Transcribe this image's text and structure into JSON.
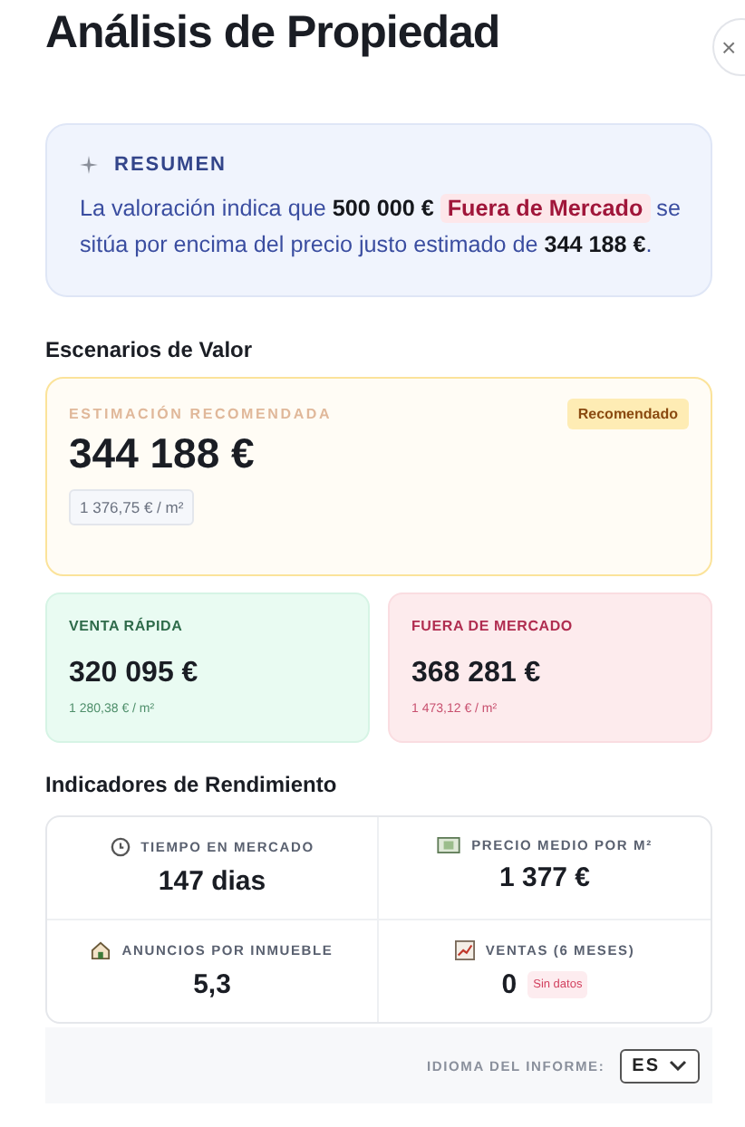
{
  "title": "Análisis de Propiedad",
  "close_button": {
    "label": "×"
  },
  "summary": {
    "heading": "RESUMEN",
    "text_before": "La valoración indica que **500 000 €**",
    "tag": "Fuera de Mercado",
    "text_after": "se sitúa por encima del precio justo estimado de **344 188 €**."
  },
  "scenarios": {
    "heading": "Escenarios de Valor",
    "recommended": {
      "label": "ESTIMACIÓN RECOMENDADA",
      "badge": "Recomendado",
      "value": "344 188 €",
      "per_m2": "1 376,75 € / m²"
    },
    "cards": [
      {
        "kind": "low",
        "label": "VENTA RÁPIDA",
        "value": "320 095 €",
        "per_m2": "1 280,38 € / m²"
      },
      {
        "kind": "high",
        "label": "FUERA DE MERCADO",
        "value": "368 281 €",
        "per_m2": "1 473,12 € / m²"
      }
    ]
  },
  "indicators": {
    "heading": "Indicadores de Rendimiento",
    "items": [
      {
        "label": "TIEMPO EN MERCADO",
        "value": "147 dias"
      },
      {
        "label": "PRECIO MEDIO POR M²",
        "value": "1 377 €"
      },
      {
        "label": "ANUNCIOS POR INMUEBLE",
        "value": "5,3"
      },
      {
        "label": "VENTAS (6 MESES)",
        "value": "0",
        "badge": "Sin datos"
      }
    ]
  },
  "footer": {
    "language_label": "IDIOMA DEL INFORME:",
    "language": "ES"
  }
}
